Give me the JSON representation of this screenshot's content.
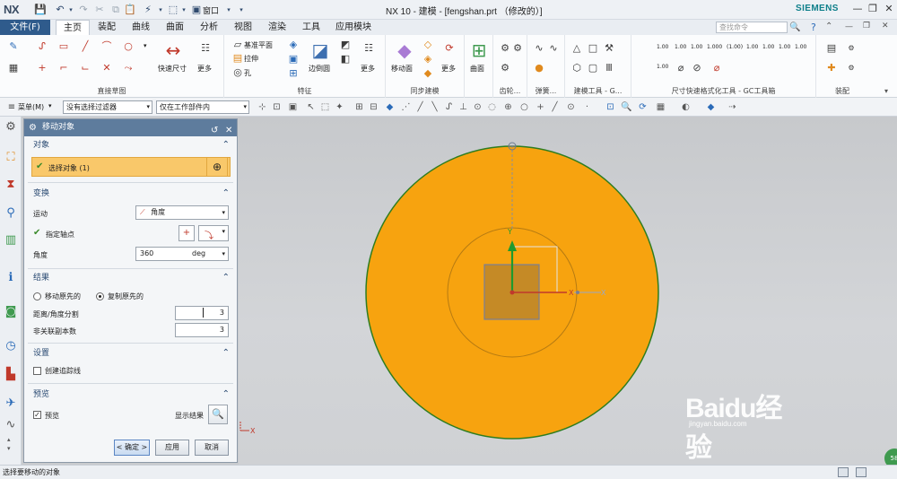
{
  "titlebar": {
    "logo": "NX",
    "window_title": "NX 10 - 建模 - [fengshan.prt （修改的）]",
    "brand": "SIEMENS",
    "window_menu_label": "窗口",
    "minimize": "—",
    "restore": "❐",
    "close": "✕"
  },
  "tabs": {
    "file": "文件(F)",
    "items": [
      "主页",
      "装配",
      "曲线",
      "曲面",
      "分析",
      "视图",
      "渲染",
      "工具",
      "应用模块"
    ],
    "active": "主页",
    "search_placeholder": "查找命令"
  },
  "ribbon": {
    "groups": {
      "sketch": "直接草图",
      "feature": "特征",
      "sync": "同步建模",
      "gear": "齿轮...",
      "spring": "弹簧...",
      "modeltool": "建模工具 - G...",
      "dimension": "尺寸快速格式化工具 - GC工具箱",
      "assembly": "装配"
    },
    "quick_dim_label": "快速尺寸",
    "more_label": "更多",
    "datum_plane": "基准平面",
    "extrude": "拉伸",
    "hole": "孔",
    "edge_blend": "边倒圆",
    "move_face": "移动面",
    "surface": "曲面",
    "dim_values": [
      "1.00",
      "1.00",
      "1.00",
      "1.000",
      "(1.00)",
      "1.00",
      "1.00",
      "1.00",
      "1.00",
      "1.00"
    ]
  },
  "selbar": {
    "menu_label": "菜单(M)",
    "filter": "没有选择过滤器",
    "scope": "仅在工作部件内"
  },
  "dialog": {
    "title": "移动对象",
    "object_section": "对象",
    "select_object": "选择对象 (1)",
    "transform_section": "变换",
    "motion_label": "运动",
    "motion_value": "角度",
    "pivot_label": "指定轴点",
    "angle_label": "角度",
    "angle_value": "360",
    "angle_unit": "deg",
    "result_section": "结果",
    "move_original": "移动原先的",
    "copy_original": "复制原先的",
    "distance_label": "距离/角度分割",
    "distance_value": "3",
    "copies_label": "非关联副本数",
    "copies_value": "3",
    "settings_section": "设置",
    "create_trace": "创建追踪线",
    "preview_section": "预览",
    "preview_label": "预览",
    "show_result": "显示结果",
    "ok": "< 确定 >",
    "apply": "应用",
    "cancel": "取消"
  },
  "viewport": {
    "axis_y": "Y",
    "axis_x": "X",
    "axis_yc": "YC",
    "axis_xc": "XC",
    "disk_color": "#f7a30f",
    "disk_edge": "#2e7d1f"
  },
  "status": {
    "message": "选择要移动的对象"
  },
  "watermark": {
    "brand": "Baidu经验",
    "url": "jingyan.baidu.com"
  }
}
